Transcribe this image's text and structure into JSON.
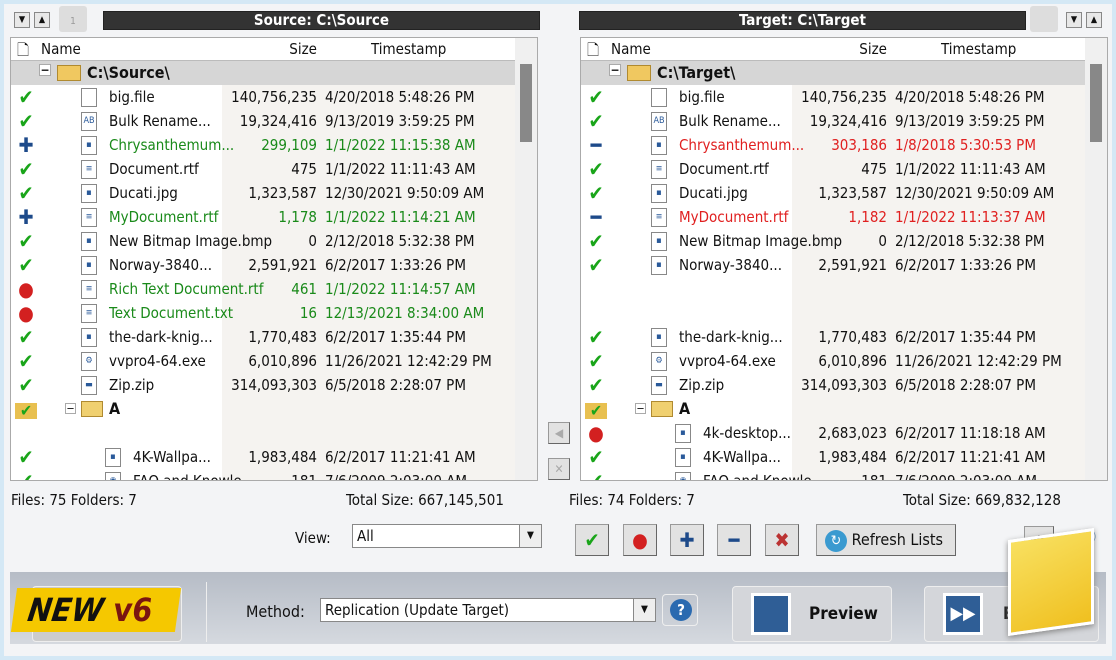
{
  "source": {
    "title": "Source: C:\\Source",
    "root": "C:\\Source\\",
    "footer_files": "Files: 75  Folders: 7",
    "footer_total": "Total Size: 667,145,501",
    "rows": [
      {
        "status": "check",
        "icon": "file",
        "name": "big.file",
        "size": "140,756,235",
        "ts": "4/20/2018 5:48:26 PM",
        "color": "normal",
        "level": 1
      },
      {
        "status": "check",
        "icon": "app",
        "name": "Bulk Rename...",
        "size": "19,324,416",
        "ts": "9/13/2019 3:59:25 PM",
        "color": "normal",
        "level": 1
      },
      {
        "status": "plus",
        "icon": "image",
        "name": "Chrysanthemum...",
        "size": "299,109",
        "ts": "1/1/2022 11:15:38 AM",
        "color": "new",
        "level": 1
      },
      {
        "status": "check",
        "icon": "doc",
        "name": "Document.rtf",
        "size": "475",
        "ts": "1/1/2022 11:11:43 AM",
        "color": "normal",
        "level": 1
      },
      {
        "status": "check",
        "icon": "image",
        "name": "Ducati.jpg",
        "size": "1,323,587",
        "ts": "12/30/2021 9:50:09 AM",
        "color": "normal",
        "level": 1
      },
      {
        "status": "plus",
        "icon": "doc",
        "name": "MyDocument.rtf",
        "size": "1,178",
        "ts": "1/1/2022 11:14:21 AM",
        "color": "new",
        "level": 1
      },
      {
        "status": "check",
        "icon": "image",
        "name": "New Bitmap Image.bmp",
        "size": "0",
        "ts": "2/12/2018 5:32:38 PM",
        "color": "normal",
        "level": 1
      },
      {
        "status": "check",
        "icon": "image",
        "name": "Norway-3840...",
        "size": "2,591,921",
        "ts": "6/2/2017 1:33:26 PM",
        "color": "normal",
        "level": 1
      },
      {
        "status": "dot",
        "icon": "doc",
        "name": "Rich Text Document.rtf",
        "size": "461",
        "ts": "1/1/2022 11:14:57 AM",
        "color": "new",
        "level": 1
      },
      {
        "status": "dot",
        "icon": "text",
        "name": "Text Document.txt",
        "size": "16",
        "ts": "12/13/2021 8:34:00 AM",
        "color": "new",
        "level": 1
      },
      {
        "status": "check",
        "icon": "image",
        "name": "the-dark-knig...",
        "size": "1,770,483",
        "ts": "6/2/2017 1:35:44 PM",
        "color": "normal",
        "level": 1
      },
      {
        "status": "check",
        "icon": "exe",
        "name": "vvpro4-64.exe",
        "size": "6,010,896",
        "ts": "11/26/2021 12:42:29 PM",
        "color": "normal",
        "level": 1
      },
      {
        "status": "check",
        "icon": "zip",
        "name": "Zip.zip",
        "size": "314,093,303",
        "ts": "6/5/2018 2:28:07 PM",
        "color": "normal",
        "level": 1
      },
      {
        "status": "foldercheck",
        "icon": "folder",
        "name": "A",
        "size": "",
        "ts": "",
        "color": "folder",
        "level": 1
      },
      null,
      {
        "status": "check",
        "icon": "image",
        "name": "4K-Wallpa...",
        "size": "1,983,484",
        "ts": "6/2/2017 11:21:41 AM",
        "color": "normal",
        "level": 2
      },
      {
        "status": "check",
        "icon": "web",
        "name": "FAQ and Knowle...",
        "size": "181",
        "ts": "7/6/2009 2:03:00 AM",
        "color": "normal",
        "level": 2
      }
    ]
  },
  "target": {
    "title": "Target: C:\\Target",
    "root": "C:\\Target\\",
    "footer_files": "Files: 74  Folders: 7",
    "footer_total": "Total Size: 669,832,128",
    "rows": [
      {
        "status": "check",
        "icon": "file",
        "name": "big.file",
        "size": "140,756,235",
        "ts": "4/20/2018 5:48:26 PM",
        "color": "normal",
        "level": 1
      },
      {
        "status": "check",
        "icon": "app",
        "name": "Bulk Rename...",
        "size": "19,324,416",
        "ts": "9/13/2019 3:59:25 PM",
        "color": "normal",
        "level": 1
      },
      {
        "status": "minus",
        "icon": "image",
        "name": "Chrysanthemum...",
        "size": "303,186",
        "ts": "1/8/2018 5:30:53 PM",
        "color": "diff",
        "level": 1
      },
      {
        "status": "check",
        "icon": "doc",
        "name": "Document.rtf",
        "size": "475",
        "ts": "1/1/2022 11:11:43 AM",
        "color": "normal",
        "level": 1
      },
      {
        "status": "check",
        "icon": "image",
        "name": "Ducati.jpg",
        "size": "1,323,587",
        "ts": "12/30/2021 9:50:09 AM",
        "color": "normal",
        "level": 1
      },
      {
        "status": "minus",
        "icon": "doc",
        "name": "MyDocument.rtf",
        "size": "1,182",
        "ts": "1/1/2022 11:13:37 AM",
        "color": "diff",
        "level": 1
      },
      {
        "status": "check",
        "icon": "image",
        "name": "New Bitmap Image.bmp",
        "size": "0",
        "ts": "2/12/2018 5:32:38 PM",
        "color": "normal",
        "level": 1
      },
      {
        "status": "check",
        "icon": "image",
        "name": "Norway-3840...",
        "size": "2,591,921",
        "ts": "6/2/2017 1:33:26 PM",
        "color": "normal",
        "level": 1
      },
      null,
      null,
      {
        "status": "check",
        "icon": "image",
        "name": "the-dark-knig...",
        "size": "1,770,483",
        "ts": "6/2/2017 1:35:44 PM",
        "color": "normal",
        "level": 1
      },
      {
        "status": "check",
        "icon": "exe",
        "name": "vvpro4-64.exe",
        "size": "6,010,896",
        "ts": "11/26/2021 12:42:29 PM",
        "color": "normal",
        "level": 1
      },
      {
        "status": "check",
        "icon": "zip",
        "name": "Zip.zip",
        "size": "314,093,303",
        "ts": "6/5/2018 2:28:07 PM",
        "color": "normal",
        "level": 1
      },
      {
        "status": "foldercheck",
        "icon": "folder",
        "name": "A",
        "size": "",
        "ts": "",
        "color": "folder",
        "level": 1
      },
      {
        "status": "dot",
        "icon": "image",
        "name": "4k-desktop...",
        "size": "2,683,023",
        "ts": "6/2/2017 11:18:18 AM",
        "color": "normal",
        "level": 2
      },
      {
        "status": "check",
        "icon": "image",
        "name": "4K-Wallpa...",
        "size": "1,983,484",
        "ts": "6/2/2017 11:21:41 AM",
        "color": "normal",
        "level": 2
      },
      {
        "status": "check",
        "icon": "web",
        "name": "FAQ and Knowle...",
        "size": "181",
        "ts": "7/6/2009 2:03:00 AM",
        "color": "normal",
        "level": 2
      }
    ]
  },
  "columns": {
    "name": "Name",
    "size": "Size",
    "timestamp": "Timestamp"
  },
  "lock_badge": "1",
  "view": {
    "label": "View:",
    "value": "All"
  },
  "refresh_label": "Refresh Lists",
  "method": {
    "label": "Method:",
    "value": "Replication (Update Target)"
  },
  "preview_label": "Preview",
  "execute_label": "Ex",
  "badge": {
    "new": "NEW",
    "ver": "v6"
  },
  "colors": {
    "new": "#1a8a1a",
    "diff": "#e02020",
    "check": "#1aa51a",
    "plus": "#1d4a8a",
    "dot": "#d32020"
  }
}
